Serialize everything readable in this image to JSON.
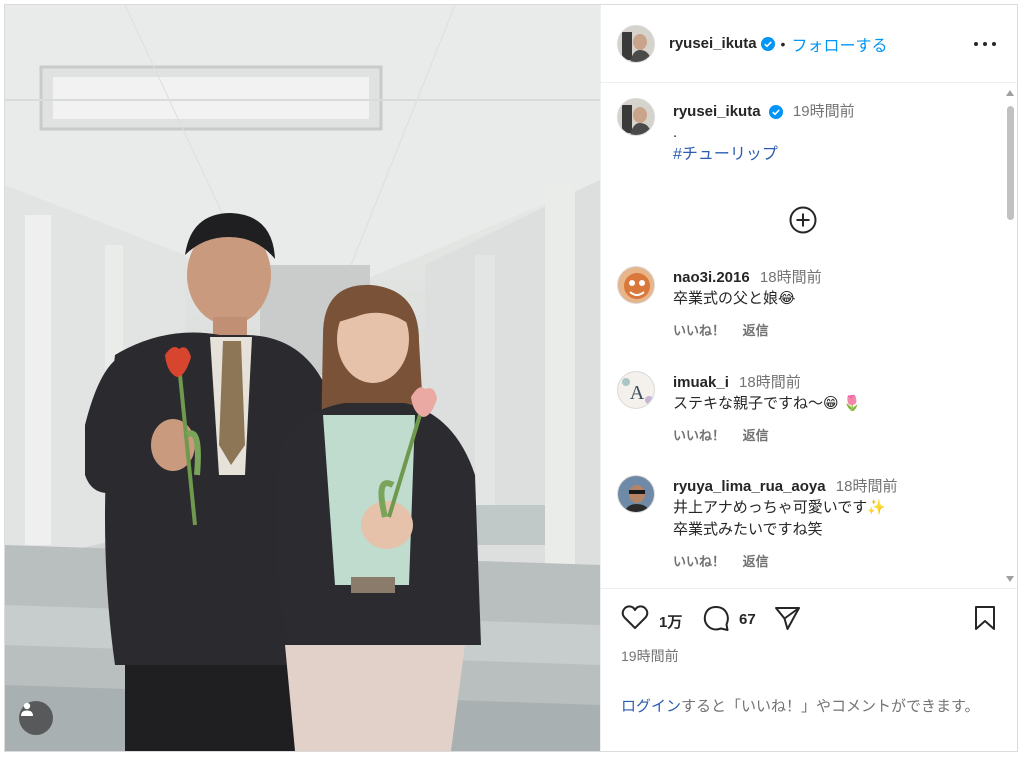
{
  "post": {
    "username": "ryusei_ikuta",
    "follow_label": "フォローする",
    "separator": "•",
    "more_icon": "more-options-icon",
    "verified_color": "#0095f6"
  },
  "caption": {
    "username": "ryusei_ikuta",
    "time": "19時間前",
    "text": ".",
    "hashtag": "#チューリップ"
  },
  "comments": [
    {
      "username": "nao3i.2016",
      "time": "18時間前",
      "text": "卒業式の父と娘",
      "emoji": "😂",
      "like_label": "いいね！",
      "reply_label": "返信"
    },
    {
      "username": "imuak_i",
      "time": "18時間前",
      "text": "ステキな親子ですね〜",
      "emoji": "😁 🌷",
      "like_label": "いいね！",
      "reply_label": "返信"
    },
    {
      "username": "ryuya_lima_rua_aoya",
      "time": "18時間前",
      "text": "井上アナめっちゃ可愛いです",
      "emoji": "✨",
      "text2": "卒業式みたいですね笑",
      "like_label": "いいね！",
      "reply_label": "返信"
    }
  ],
  "stats": {
    "likes": "1万",
    "comments": "67",
    "posted": "19時間前"
  },
  "login": {
    "link": "ログイン",
    "rest": "すると「いいね！」やコメントができます。"
  },
  "colors": {
    "accent": "#0095f6",
    "link": "#2a5db0",
    "muted": "#737373",
    "text": "#262626"
  }
}
